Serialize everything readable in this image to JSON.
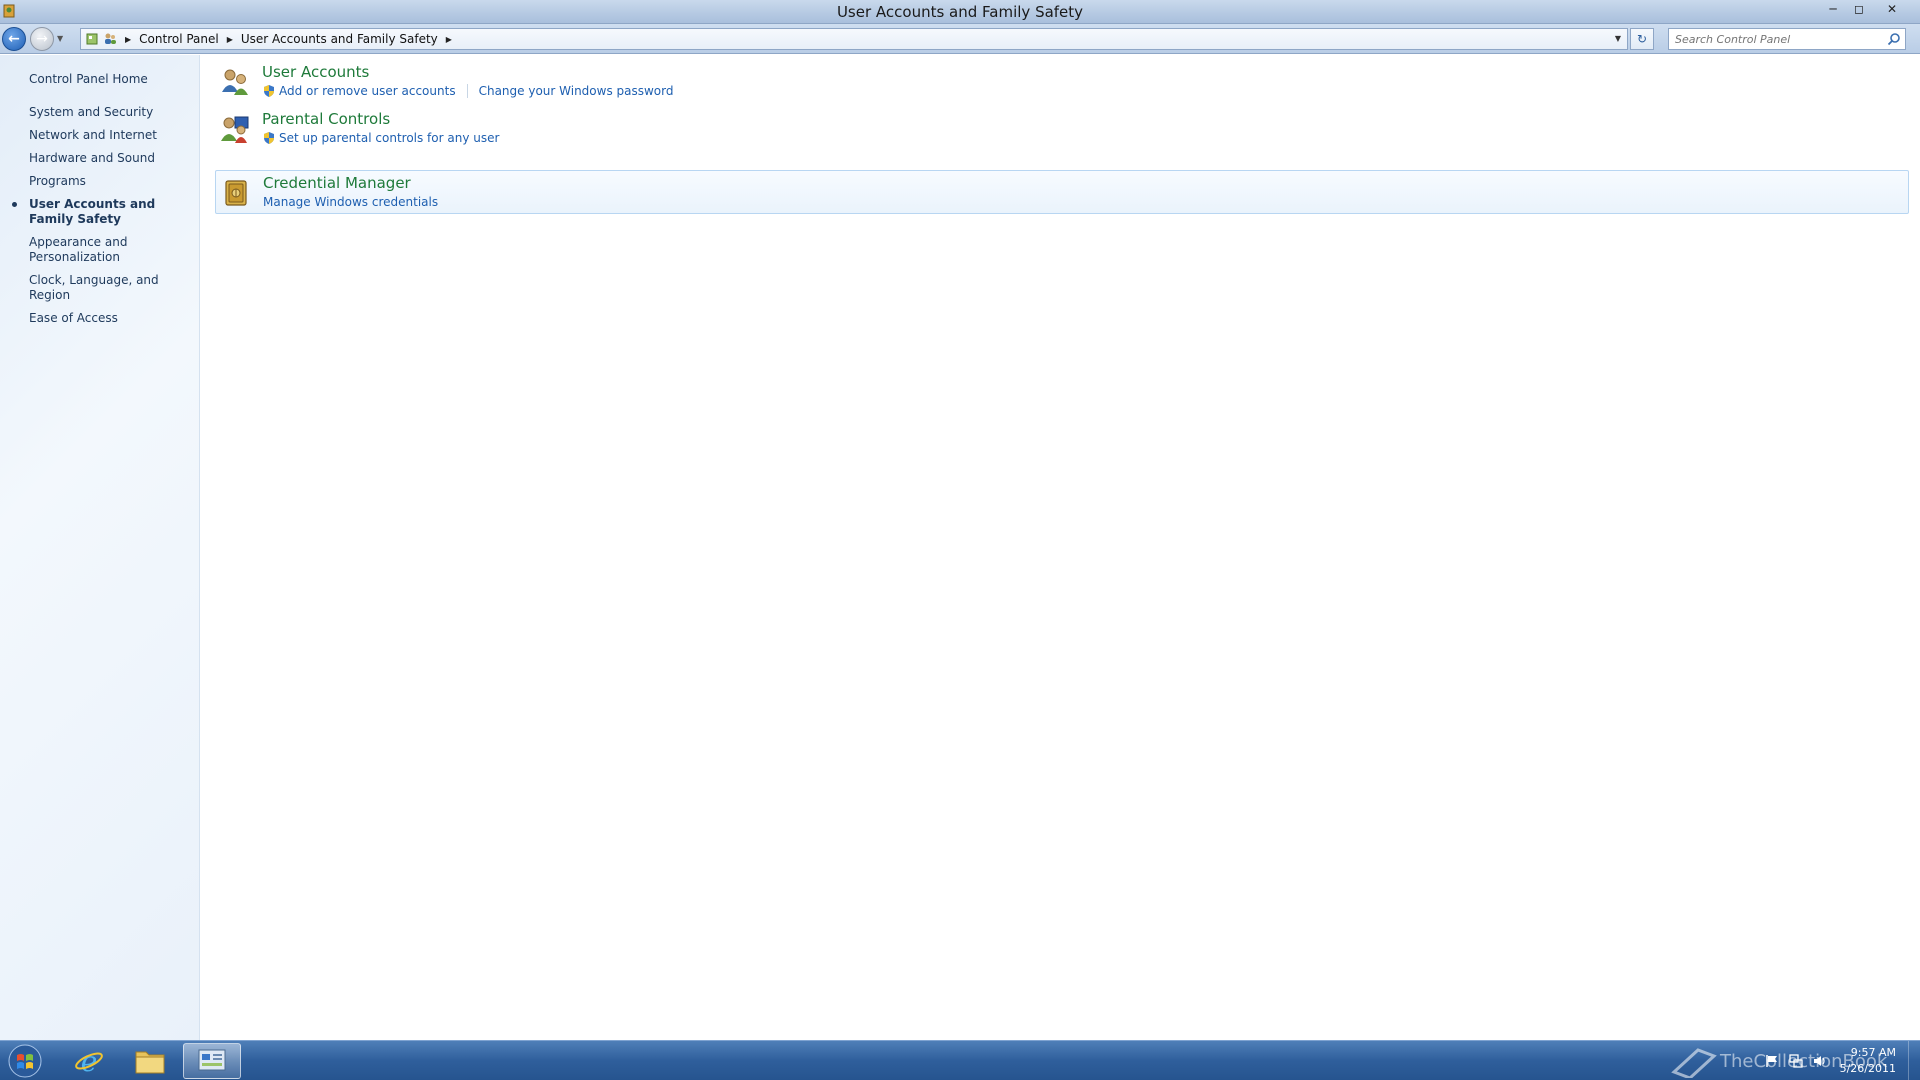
{
  "window": {
    "title": "User Accounts and Family Safety"
  },
  "address_bar": {
    "breadcrumbs": [
      "Control Panel",
      "User Accounts and Family Safety"
    ],
    "search_placeholder": "Search Control Panel"
  },
  "sidebar": {
    "home": "Control Panel Home",
    "items": [
      {
        "label": "System and Security",
        "active": false
      },
      {
        "label": "Network and Internet",
        "active": false
      },
      {
        "label": "Hardware and Sound",
        "active": false
      },
      {
        "label": "Programs",
        "active": false
      },
      {
        "label": "User Accounts and Family Safety",
        "active": true
      },
      {
        "label": "Appearance and Personalization",
        "active": false
      },
      {
        "label": "Clock, Language, and Region",
        "active": false
      },
      {
        "label": "Ease of Access",
        "active": false
      }
    ]
  },
  "categories": [
    {
      "title": "User Accounts",
      "icon": "users-icon",
      "links": [
        "Add or remove user accounts",
        "Change your Windows password"
      ]
    },
    {
      "title": "Parental Controls",
      "icon": "parental-controls-icon",
      "links": [
        "Set up parental controls for any user"
      ]
    },
    {
      "title": "Credential Manager",
      "icon": "vault-icon",
      "links": [
        "Manage Windows credentials"
      ]
    }
  ],
  "taskbar": {
    "clock_time": "9:57 AM",
    "clock_date": "5/26/2011",
    "watermark": "TheCollectionBook"
  },
  "colors": {
    "category_title": "#1e7a3a",
    "link": "#1e5fb0",
    "sidebar_text": "#1e395b",
    "taskbar": "#2f5f9c"
  }
}
